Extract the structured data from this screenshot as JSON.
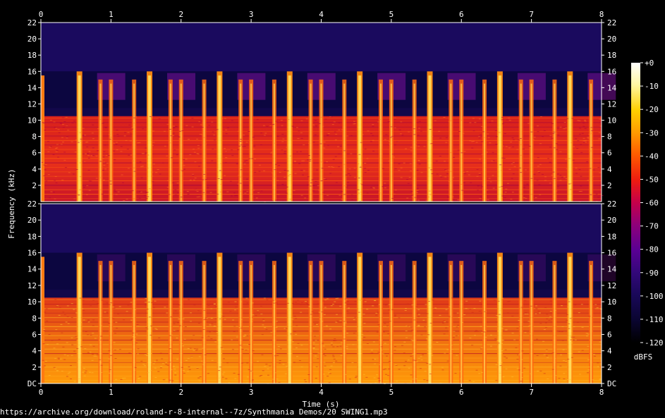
{
  "source_url": "https://archive.org/download/roland-r-8-internal--7z/Synthmania Demos/20 SWING1.mp3",
  "chart_data": {
    "type": "heatmap",
    "subtype": "spectrogram",
    "channels": 2,
    "xlabel": "Time (s)",
    "ylabel": "Frequency (kHz)",
    "xlim": [
      0,
      8
    ],
    "ylim": [
      0,
      22
    ],
    "x_ticks": [
      "0",
      "1",
      "2",
      "3",
      "4",
      "5",
      "6",
      "7",
      "8"
    ],
    "y_ticks_top": [
      "2",
      "4",
      "6",
      "8",
      "10",
      "12",
      "14",
      "16",
      "18",
      "20",
      "22"
    ],
    "y_ticks_bottom": [
      "DC",
      "2",
      "4",
      "6",
      "8",
      "10",
      "12",
      "14",
      "16",
      "18",
      "20",
      "22"
    ],
    "colorbar": {
      "label": "dBFS",
      "range": [
        -120,
        0
      ],
      "ticks": [
        "+0",
        "-10",
        "-20",
        "-30",
        "-40",
        "-50",
        "-60",
        "-70",
        "-80",
        "-90",
        "-100",
        "-110",
        "-120"
      ],
      "colors": [
        "#ffffff",
        "#fff6a0",
        "#ffd000",
        "#ff9a00",
        "#ff5a00",
        "#ee1c10",
        "#c5004a",
        "#8e007a",
        "#5a0094",
        "#33087a",
        "#190858",
        "#0a0530",
        "#000000"
      ]
    },
    "transients_s": [
      0.55,
      1.55,
      2.55,
      3.55,
      4.55,
      5.55,
      6.55,
      7.55
    ],
    "energy_band_khz": [
      0,
      10.5
    ],
    "cutoff_khz": 16
  }
}
